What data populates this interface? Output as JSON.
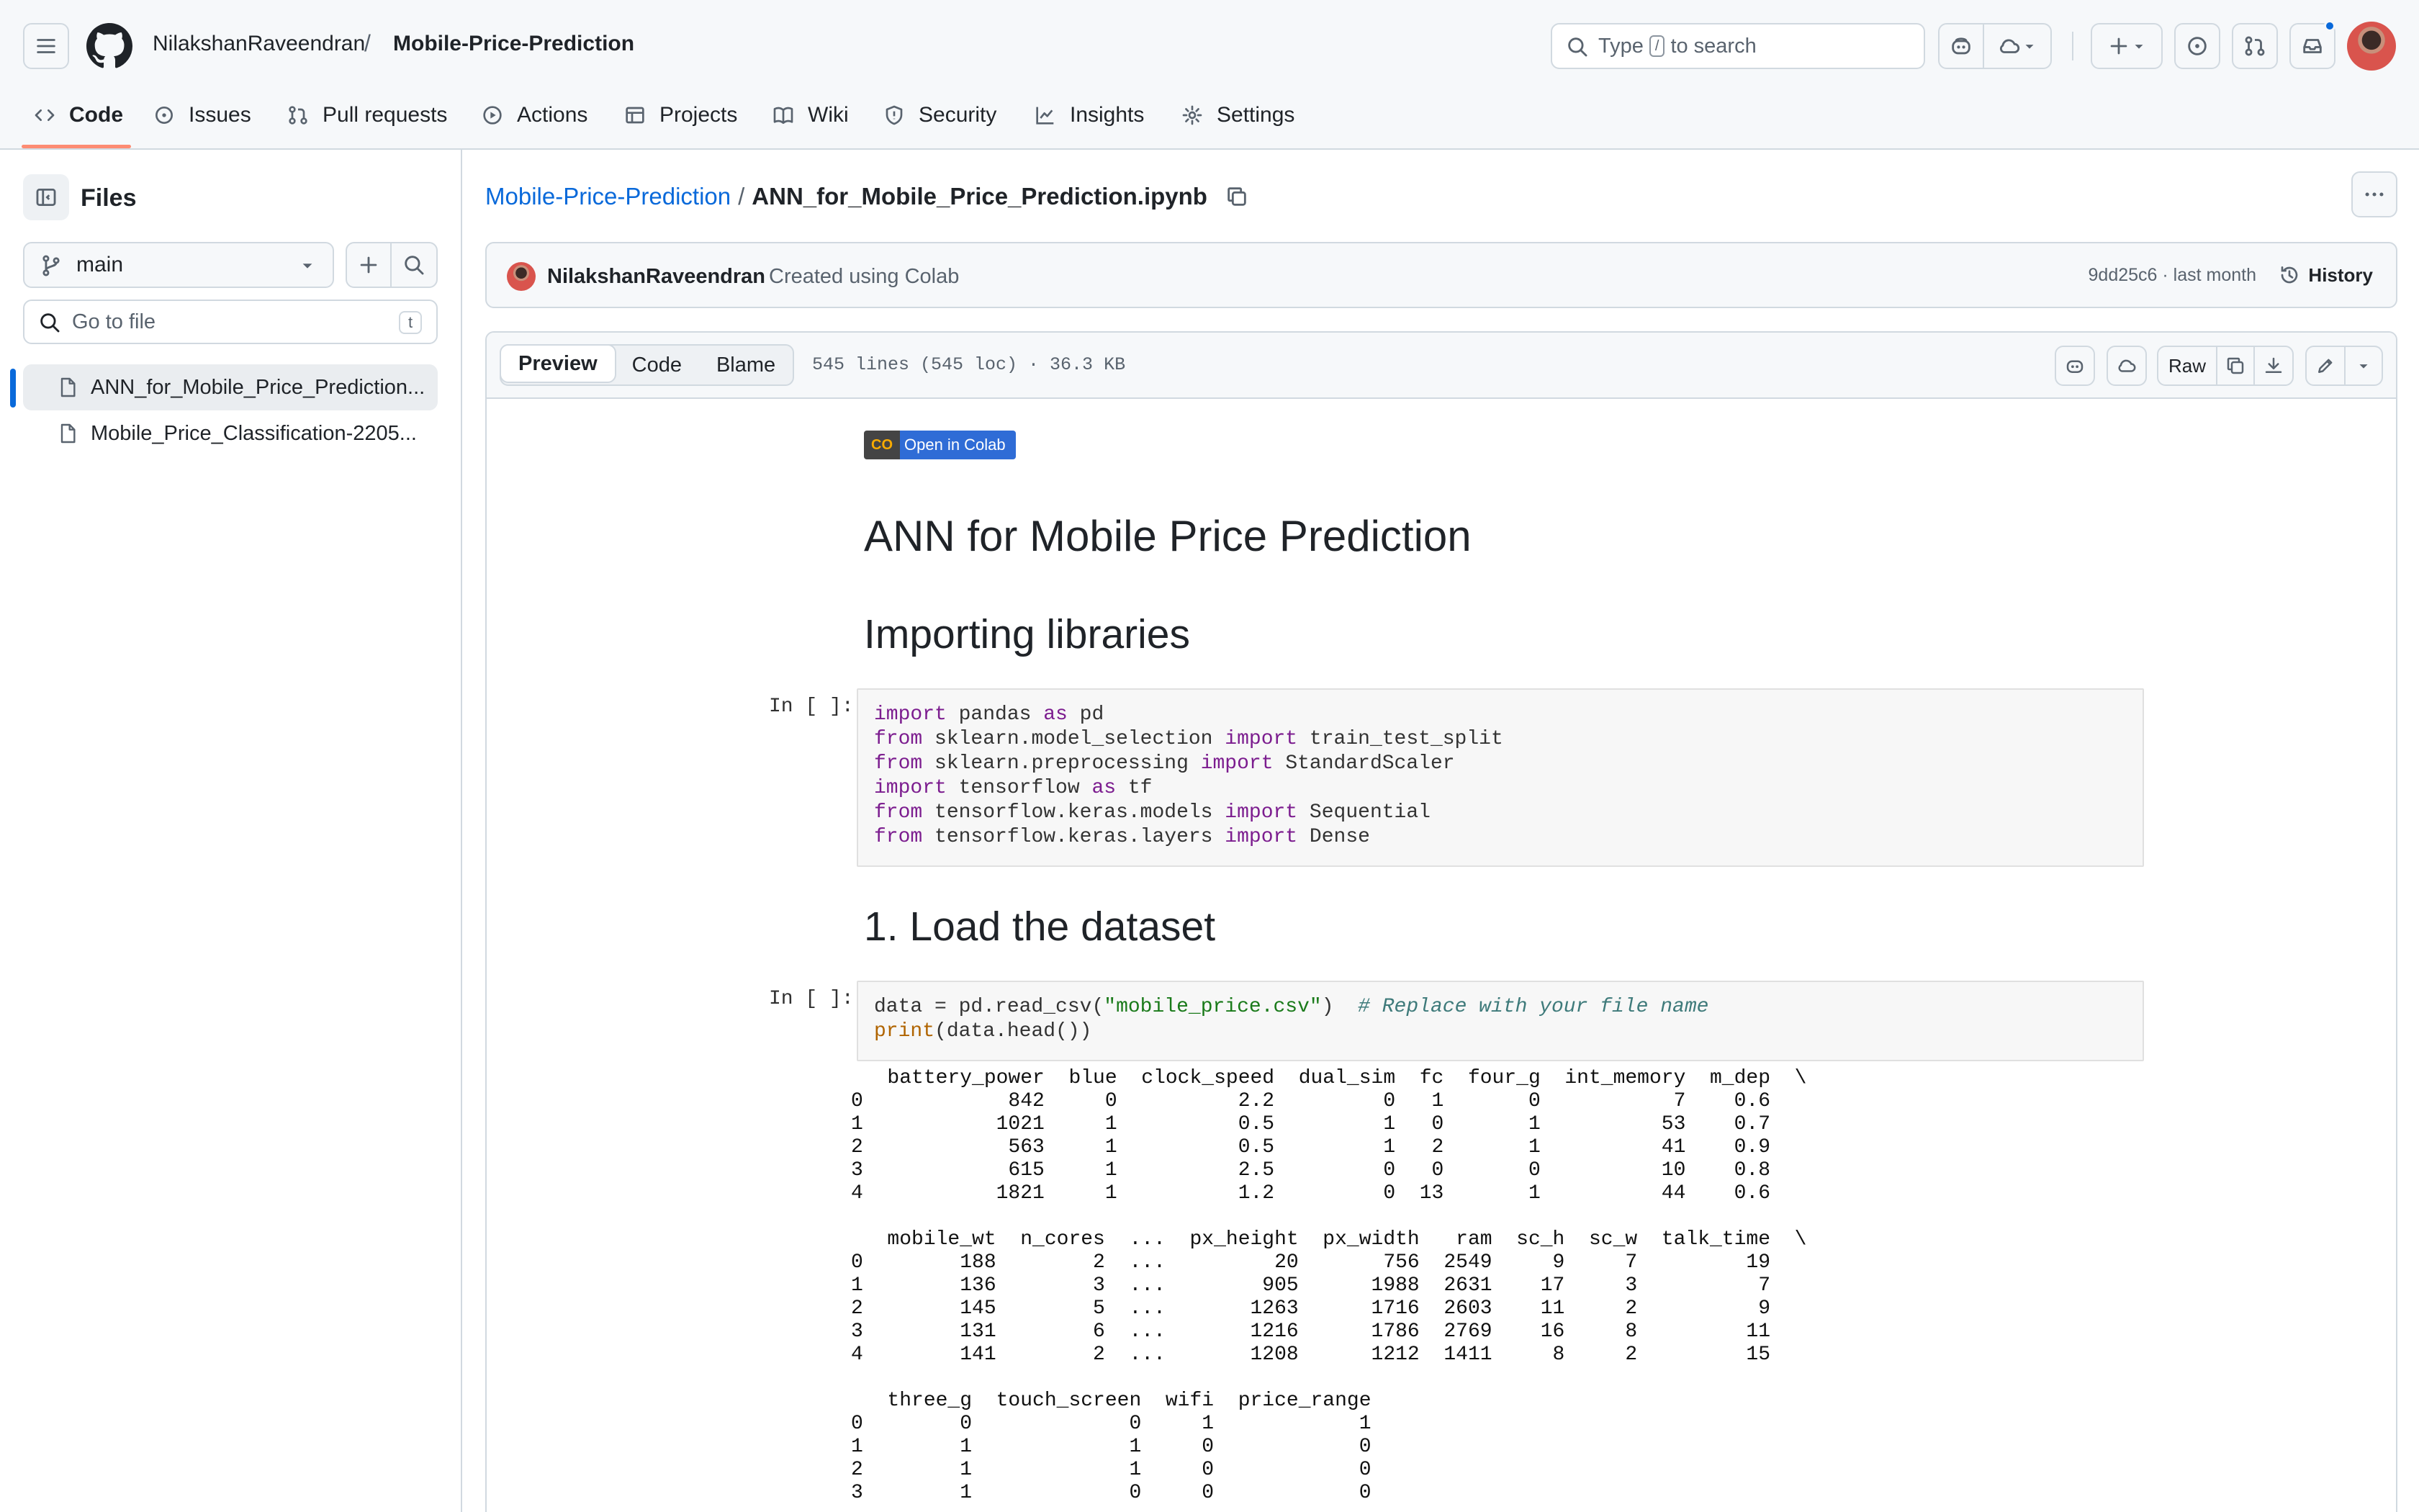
{
  "header": {
    "owner": "NilakshanRaveendran",
    "separator": "/",
    "repo": "Mobile-Price-Prediction",
    "search_prefix": "Type",
    "search_key": "/",
    "search_suffix": "to search"
  },
  "nav": {
    "tabs": [
      {
        "label": "Code",
        "icon": "code-icon",
        "active": true
      },
      {
        "label": "Issues",
        "icon": "issue-icon"
      },
      {
        "label": "Pull requests",
        "icon": "pull-request-icon"
      },
      {
        "label": "Actions",
        "icon": "play-icon"
      },
      {
        "label": "Projects",
        "icon": "table-icon"
      },
      {
        "label": "Wiki",
        "icon": "book-icon"
      },
      {
        "label": "Security",
        "icon": "shield-icon"
      },
      {
        "label": "Insights",
        "icon": "graph-icon"
      },
      {
        "label": "Settings",
        "icon": "gear-icon"
      }
    ]
  },
  "sidebar": {
    "title": "Files",
    "branch": "main",
    "goto_placeholder": "Go to file",
    "goto_key": "t",
    "files": [
      {
        "name": "ANN_for_Mobile_Price_Prediction...",
        "selected": true
      },
      {
        "name": "Mobile_Price_Classification-2205..."
      }
    ]
  },
  "file": {
    "breadcrumb_repo": "Mobile-Price-Prediction",
    "breadcrumb_sep": "/",
    "breadcrumb_file": "ANN_for_Mobile_Price_Prediction.ipynb",
    "commit_author": "NilakshanRaveendran",
    "commit_message": "Created using Colab",
    "commit_meta": "9dd25c6 · last month",
    "history_label": "History",
    "tabs": [
      "Preview",
      "Code",
      "Blame"
    ],
    "active_tab": "Preview",
    "stats": "545 lines (545 loc) · 36.3 KB",
    "raw_label": "Raw"
  },
  "notebook": {
    "badge": "Open in Colab",
    "badge_logo": "CO",
    "title": "ANN for Mobile Price Prediction",
    "section1": "Importing libraries",
    "prompt1": "In [ ]:",
    "section2": "1. Load the dataset",
    "prompt2": "In [ ]:",
    "cell1_lines": [
      [
        [
          "kw",
          "import"
        ],
        [
          "t",
          " pandas "
        ],
        [
          "kw",
          "as"
        ],
        [
          "t",
          " pd"
        ]
      ],
      [
        [
          "kw",
          "from"
        ],
        [
          "t",
          " sklearn.model_selection "
        ],
        [
          "kw",
          "import"
        ],
        [
          "t",
          " train_test_split"
        ]
      ],
      [
        [
          "kw",
          "from"
        ],
        [
          "t",
          " sklearn.preprocessing "
        ],
        [
          "kw",
          "import"
        ],
        [
          "t",
          " StandardScaler"
        ]
      ],
      [
        [
          "kw",
          "import"
        ],
        [
          "t",
          " tensorflow "
        ],
        [
          "kw",
          "as"
        ],
        [
          "t",
          " tf"
        ]
      ],
      [
        [
          "kw",
          "from"
        ],
        [
          "t",
          " tensorflow.keras.models "
        ],
        [
          "kw",
          "import"
        ],
        [
          "t",
          " Sequential"
        ]
      ],
      [
        [
          "kw",
          "from"
        ],
        [
          "t",
          " tensorflow.keras.layers "
        ],
        [
          "kw",
          "import"
        ],
        [
          "t",
          " Dense"
        ]
      ]
    ],
    "cell2_lines": [
      [
        [
          "t",
          "data = pd.read_csv("
        ],
        [
          "str",
          "\"mobile_price.csv\""
        ],
        [
          "t",
          ")  "
        ],
        [
          "com",
          "# Replace with your file name"
        ]
      ],
      [
        [
          "bi",
          "print"
        ],
        [
          "t",
          "(data.head())"
        ]
      ]
    ],
    "output_lines": [
      "   battery_power  blue  clock_speed  dual_sim  fc  four_g  int_memory  m_dep  \\",
      "0            842     0          2.2         0   1       0           7    0.6   ",
      "1           1021     1          0.5         1   0       1          53    0.7   ",
      "2            563     1          0.5         1   2       1          41    0.9   ",
      "3            615     1          2.5         0   0       0          10    0.8   ",
      "4           1821     1          1.2         0  13       1          44    0.6   ",
      "",
      "   mobile_wt  n_cores  ...  px_height  px_width   ram  sc_h  sc_w  talk_time  \\",
      "0        188        2  ...         20       756  2549     9     7         19   ",
      "1        136        3  ...        905      1988  2631    17     3          7   ",
      "2        145        5  ...       1263      1716  2603    11     2          9   ",
      "3        131        6  ...       1216      1786  2769    16     8         11   ",
      "4        141        2  ...       1208      1212  1411     8     2         15   ",
      "",
      "   three_g  touch_screen  wifi  price_range",
      "0        0             0     1            1",
      "1        1             1     0            0",
      "2        1             1     0            0",
      "3        1             0     0            0"
    ]
  },
  "colors": {
    "accent": "#0969da",
    "nav_underline": "#fd8c73",
    "keyword": "#7c1d8f",
    "string": "#1a7a1a",
    "comment": "#3e7a7a"
  }
}
